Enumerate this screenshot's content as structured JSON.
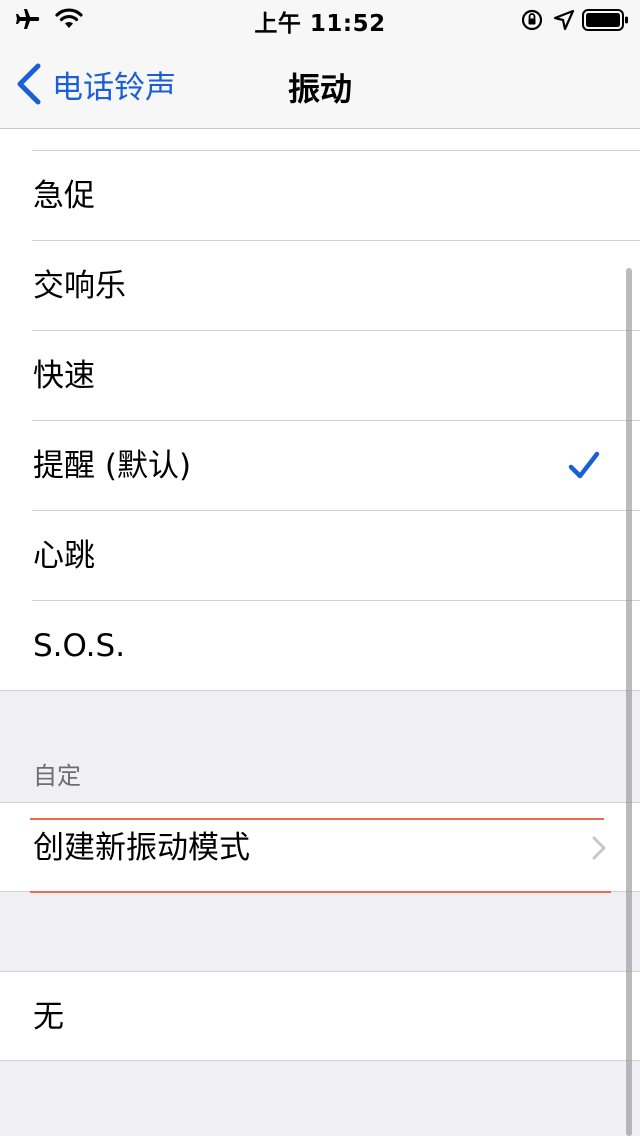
{
  "status_bar": {
    "time": "上午 11:52"
  },
  "nav": {
    "back_label": "电话铃声",
    "title": "振动"
  },
  "standard": [
    {
      "label": "急促",
      "selected": false
    },
    {
      "label": "交响乐",
      "selected": false
    },
    {
      "label": "快速",
      "selected": false
    },
    {
      "label": "提醒 (默认)",
      "selected": true
    },
    {
      "label": "心跳",
      "selected": false
    },
    {
      "label": "S.O.S.",
      "selected": false
    }
  ],
  "custom": {
    "header": "自定",
    "create_label": "创建新振动模式"
  },
  "none_label": "无",
  "colors": {
    "accent": "#1a5fd6",
    "highlight": "#ec6b4a",
    "background": "#efeff4"
  }
}
